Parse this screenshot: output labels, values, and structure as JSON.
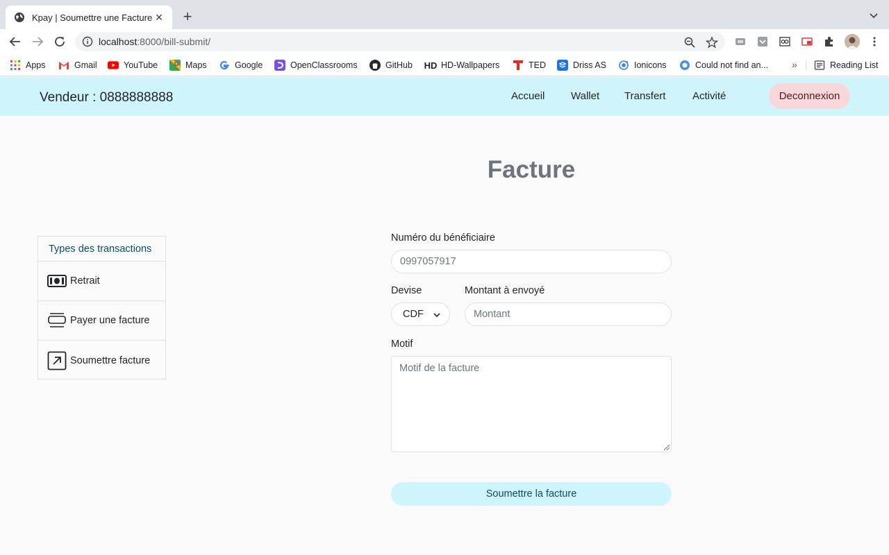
{
  "browser": {
    "tab_title": "Kpay | Soumettre une Facture",
    "url_host": "localhost",
    "url_rest": ":8000/bill-submit/",
    "bookmarks": [
      "Apps",
      "Gmail",
      "YouTube",
      "Maps",
      "Google",
      "OpenClassrooms",
      "GitHub",
      "HD-Wallpapers",
      "TED",
      "Driss AS",
      "Ionicons",
      "Could not find an..."
    ],
    "reading_list": "Reading List"
  },
  "navbar": {
    "brand": "Vendeur : 0888888888",
    "links": [
      "Accueil",
      "Wallet",
      "Transfert",
      "Activité"
    ],
    "logout": "Deconnexion"
  },
  "page": {
    "title": "Facture"
  },
  "sidebar": {
    "heading": "Types des transactions",
    "items": [
      {
        "label": "Retrait",
        "icon": "cash-icon"
      },
      {
        "label": "Payer une facture",
        "icon": "bill-icon"
      },
      {
        "label": "Soumettre facture",
        "icon": "arrow-up-right-box-icon"
      }
    ]
  },
  "form": {
    "beneficiary_label": "Numéro du bénéficiaire",
    "beneficiary_value": "0997057917",
    "currency_label": "Devise",
    "currency_value": "CDF",
    "amount_label": "Montant à envoyé",
    "amount_placeholder": "Montant",
    "motif_label": "Motif",
    "motif_placeholder": "Motif de la facture",
    "submit_label": "Soumettre la facture"
  },
  "colors": {
    "navbar_bg": "#cff4fc",
    "logout_bg": "#f8d7da",
    "submit_bg": "#cff4fc",
    "page_bg": "#fafafa"
  }
}
